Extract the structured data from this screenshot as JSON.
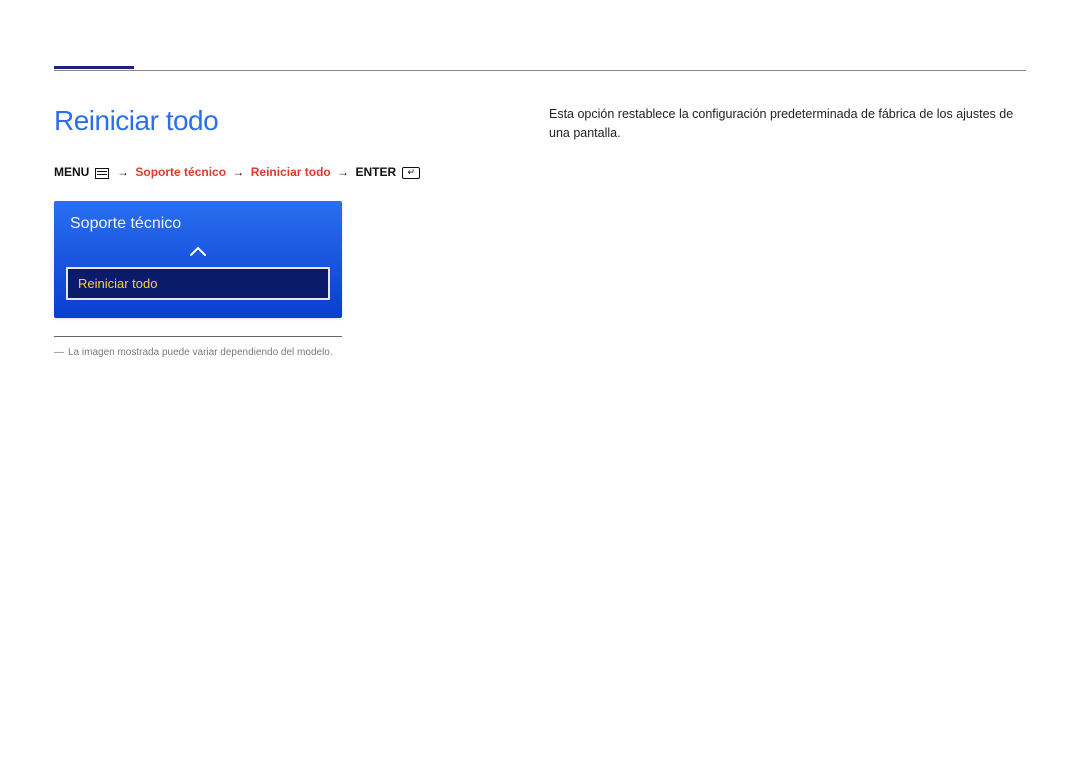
{
  "page": {
    "title": "Reiniciar todo"
  },
  "breadcrumb": {
    "menu": "MENU",
    "sep": "→",
    "item1": "Soporte técnico",
    "item2": "Reiniciar todo",
    "enter": "ENTER"
  },
  "osd": {
    "panel_title": "Soporte técnico",
    "selected_item": "Reiniciar todo"
  },
  "footnote": {
    "dash": "―",
    "text": "La imagen mostrada puede variar dependiendo del modelo."
  },
  "description": "Esta opción restablece la configuración predeterminada de fábrica de los ajustes de una pantalla."
}
